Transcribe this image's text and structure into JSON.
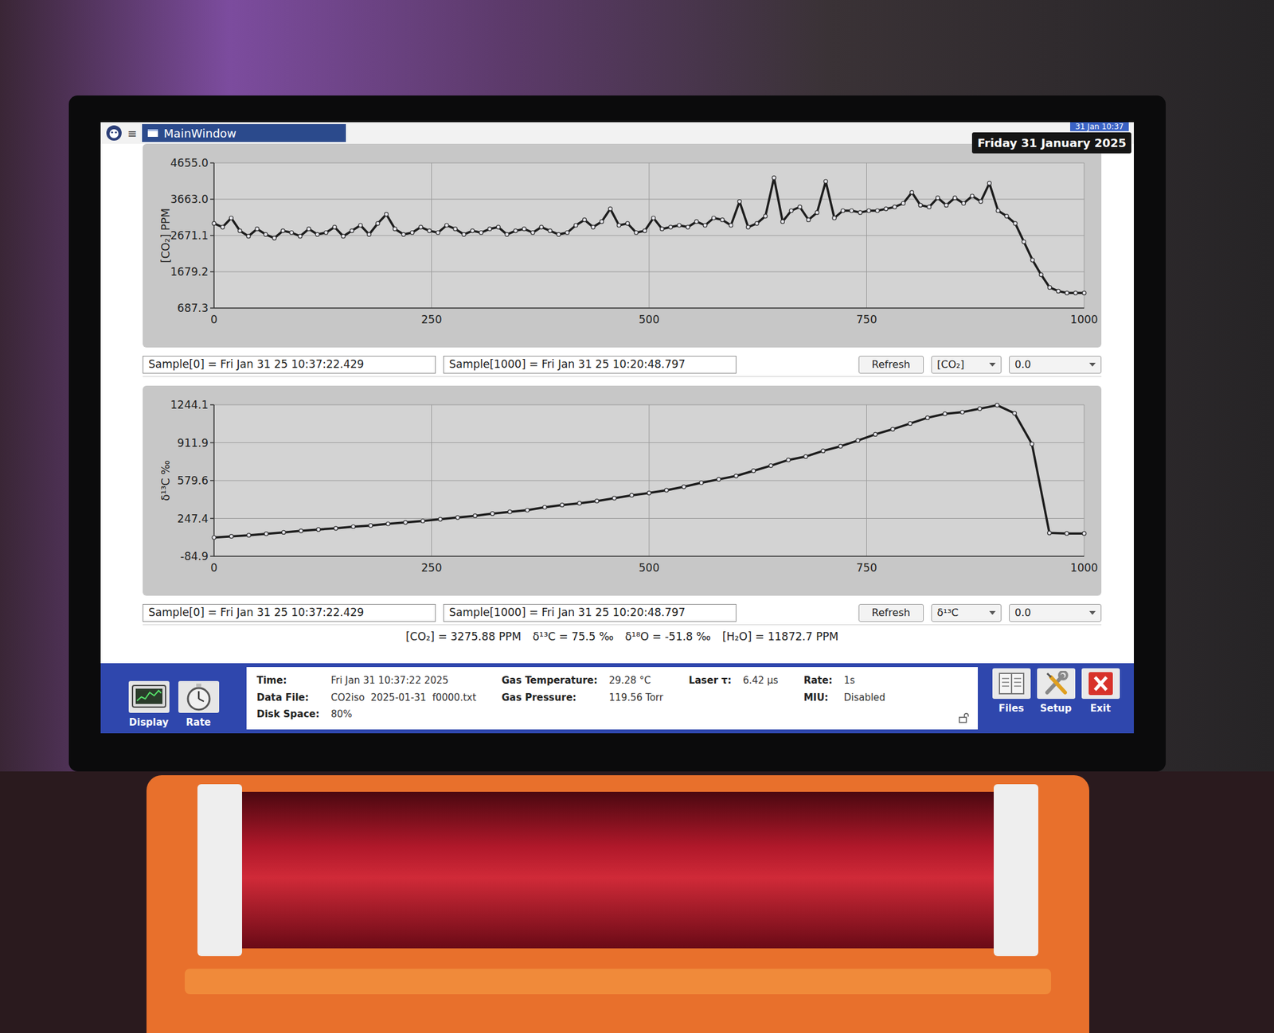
{
  "window": {
    "title": "MainWindow",
    "menu_glyph": "≡",
    "clock": "31 Jan 10:37",
    "date_badge": "Friday 31 January 2025"
  },
  "charts": [
    {
      "y_label": "[CO₂] PPM",
      "y_ticks": [
        "4655.0",
        "3663.0",
        "2671.1",
        "1679.2",
        "687.3"
      ],
      "x_ticks": [
        "0",
        "250",
        "500",
        "750",
        "1000"
      ],
      "series": [
        {
          "name": "CO2",
          "values": [
            3000,
            2900,
            3150,
            2800,
            2650,
            2850,
            2700,
            2600,
            2800,
            2750,
            2650,
            2850,
            2700,
            2750,
            2900,
            2650,
            2800,
            2950,
            2700,
            3000,
            3250,
            2850,
            2700,
            2750,
            2900,
            2800,
            2750,
            2950,
            2850,
            2700,
            2800,
            2750,
            2850,
            2900,
            2700,
            2800,
            2850,
            2750,
            2900,
            2800,
            2700,
            2750,
            2950,
            3100,
            2900,
            3050,
            3400,
            2950,
            3000,
            2750,
            2800,
            3150,
            2850,
            2900,
            2950,
            2900,
            3050,
            2950,
            3150,
            3100,
            2950,
            3600,
            2900,
            3000,
            3200,
            4250,
            3050,
            3350,
            3450,
            3100,
            3300,
            4150,
            3150,
            3350,
            3350,
            3300,
            3350,
            3350,
            3400,
            3450,
            3550,
            3850,
            3500,
            3450,
            3700,
            3500,
            3700,
            3550,
            3750,
            3600,
            4100,
            3350,
            3200,
            3000,
            2500,
            2000,
            1600,
            1250,
            1150,
            1100,
            1100,
            1100
          ]
        }
      ],
      "sample_start": "Sample[0] = Fri Jan 31 25 10:37:22.429",
      "sample_end": "Sample[1000] = Fri Jan 31 25 10:20:48.797",
      "refresh": "Refresh",
      "channel": "[CO₂]",
      "offset": "0.0"
    },
    {
      "y_label": "δ¹³C ‰",
      "y_ticks": [
        "1244.1",
        "911.9",
        "579.6",
        "247.4",
        "-84.9"
      ],
      "x_ticks": [
        "0",
        "250",
        "500",
        "750",
        "1000"
      ],
      "series": [
        {
          "name": "d13C",
          "values": [
            80,
            90,
            100,
            112,
            125,
            138,
            150,
            160,
            175,
            185,
            200,
            212,
            225,
            240,
            255,
            270,
            290,
            305,
            320,
            345,
            365,
            380,
            400,
            425,
            450,
            470,
            495,
            525,
            560,
            590,
            620,
            665,
            710,
            760,
            790,
            840,
            880,
            930,
            985,
            1030,
            1080,
            1130,
            1165,
            1180,
            1210,
            1240,
            1170,
            900,
            120,
            115,
            115
          ]
        }
      ],
      "sample_start": "Sample[0] = Fri Jan 31 25 10:37:22.429",
      "sample_end": "Sample[1000] = Fri Jan 31 25 10:20:48.797",
      "refresh": "Refresh",
      "channel": "δ¹³C",
      "offset": "0.0"
    }
  ],
  "readout": [
    "[CO₂] = 3275.88 PPM",
    "δ¹³C = 75.5 ‰",
    "δ¹⁸O = -51.8 ‰",
    "[H₂O] = 11872.7 PPM"
  ],
  "status_bar": {
    "buttons_left": [
      {
        "label": "Display"
      },
      {
        "label": "Rate"
      }
    ],
    "field_groups": [
      [
        {
          "label": "Time:",
          "value": "Fri Jan 31 10:37:22 2025"
        },
        {
          "label": "Data File:",
          "value": "CO2iso  2025-01-31  f0000.txt"
        },
        {
          "label": "Disk Space:",
          "value": "80%"
        }
      ],
      [
        {
          "label": "Gas Temperature:",
          "value": "29.28 °C"
        },
        {
          "label": "Gas Pressure:",
          "value": "119.56 Torr"
        }
      ],
      [
        {
          "label": "Laser τ:",
          "value": "6.42 µs"
        }
      ],
      [
        {
          "label": "Rate:",
          "value": "1s"
        },
        {
          "label": "MIU:",
          "value": "Disabled"
        }
      ]
    ],
    "buttons_right": [
      {
        "label": "Files"
      },
      {
        "label": "Setup"
      },
      {
        "label": "Exit"
      }
    ]
  }
}
